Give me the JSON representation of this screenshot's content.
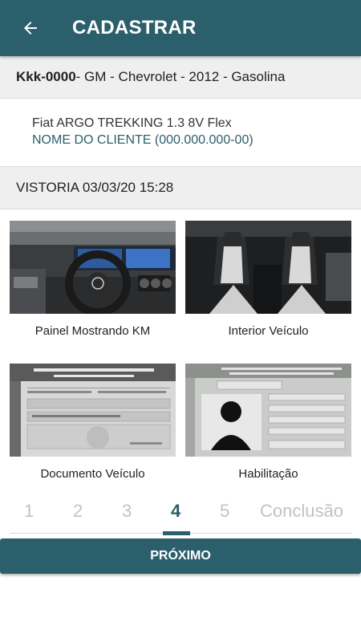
{
  "appbar": {
    "title": "CADASTRAR",
    "back_icon": "arrow-left-icon"
  },
  "vehicle": {
    "plate": "Kkk-0000",
    "details": " - GM - Chevrolet - 2012 - Gasolina"
  },
  "client": {
    "model": "Fiat ARGO TREKKING 1.3 8V Flex",
    "name": "NOME DO CLIENTE (000.000.000-00)"
  },
  "inspection": {
    "label": "VISTORIA 03/03/20 15:28"
  },
  "photos": [
    {
      "label": "Painel Mostrando KM"
    },
    {
      "label": "Interior Veículo"
    },
    {
      "label": "Documento Veículo"
    },
    {
      "label": "Habilitação"
    }
  ],
  "steps": [
    "1",
    "2",
    "3",
    "4",
    "5",
    "Conclusão"
  ],
  "active_step": "4",
  "next_button": "PRÓXIMO",
  "colors": {
    "primary": "#2c5f6c",
    "inactive": "#c2c2c2",
    "band": "#efefef"
  }
}
